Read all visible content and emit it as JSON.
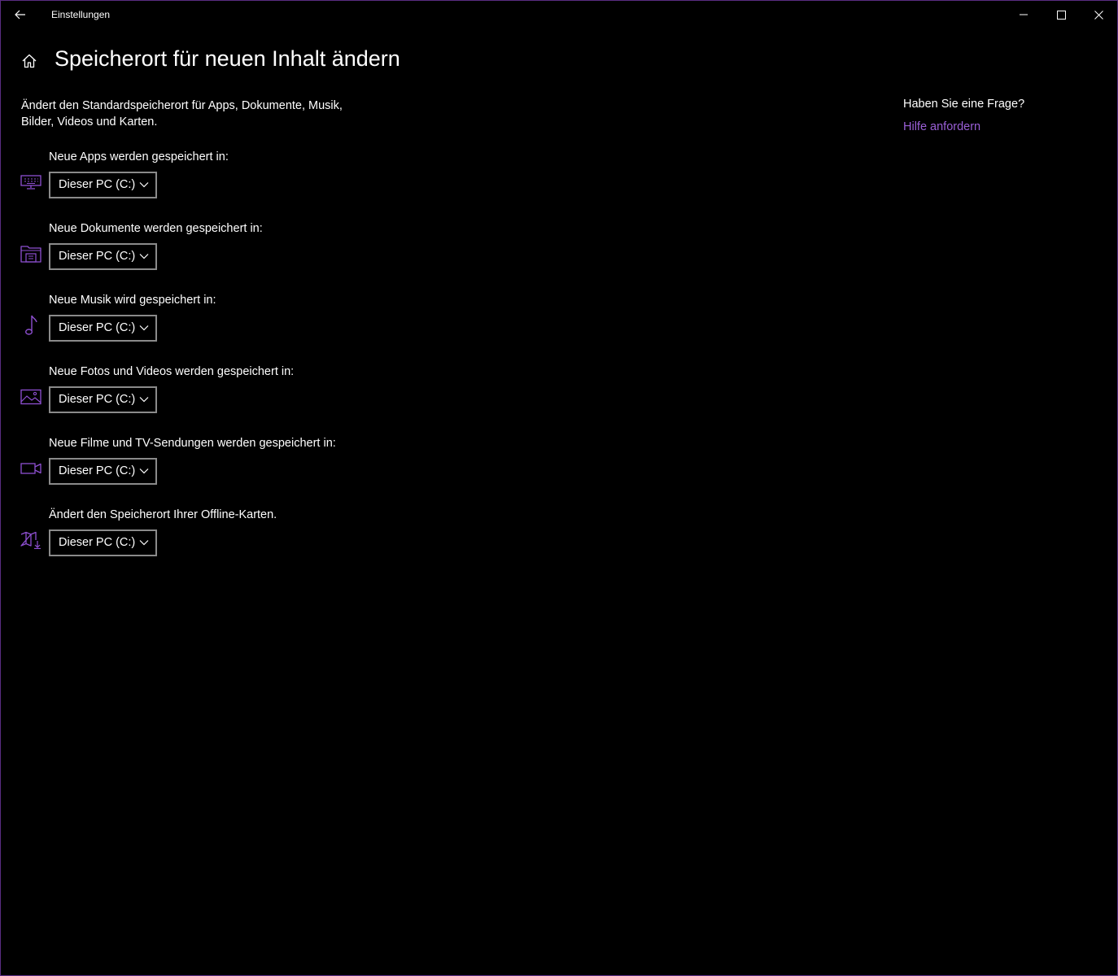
{
  "window": {
    "title": "Einstellungen",
    "border_color": "#5a2d82"
  },
  "titlebar": {
    "back_icon": "back-arrow-icon",
    "minimize_icon": "minimize-icon",
    "maximize_icon": "maximize-icon",
    "close_icon": "close-icon"
  },
  "header": {
    "home_icon": "home-icon",
    "title": "Speicherort für neuen Inhalt ändern"
  },
  "description": "Ändert den Standardspeicherort für Apps, Dokumente, Musik, Bilder, Videos und Karten.",
  "settings": [
    {
      "label": "Neue Apps werden gespeichert in:",
      "icon": "apps-monitor-icon",
      "value": "Dieser PC (C:)"
    },
    {
      "label": "Neue Dokumente werden gespeichert in:",
      "icon": "documents-folder-icon",
      "value": "Dieser PC (C:)"
    },
    {
      "label": "Neue Musik wird gespeichert in:",
      "icon": "music-note-icon",
      "value": "Dieser PC (C:)"
    },
    {
      "label": "Neue Fotos und Videos werden gespeichert in:",
      "icon": "photo-icon",
      "value": "Dieser PC (C:)"
    },
    {
      "label": "Neue Filme und TV-Sendungen werden gespeichert in:",
      "icon": "video-camera-icon",
      "value": "Dieser PC (C:)"
    },
    {
      "label": "Ändert den Speicherort Ihrer Offline-Karten.",
      "icon": "offline-map-icon",
      "value": "Dieser PC (C:)"
    }
  ],
  "help": {
    "title": "Haben Sie eine Frage?",
    "link": "Hilfe anfordern"
  },
  "colors": {
    "accent": "#8e4fd1",
    "link": "#9a5fd6",
    "background": "#000000",
    "text": "#ffffff",
    "dropdown_border": "#8a8a8a"
  }
}
